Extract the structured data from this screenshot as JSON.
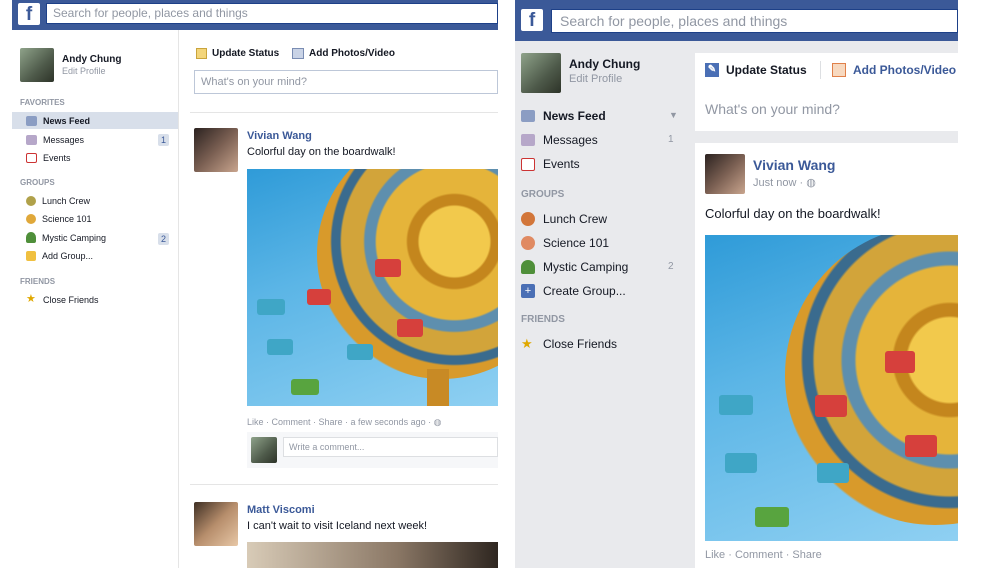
{
  "search": {
    "placeholder": "Search for people, places and things"
  },
  "logo": "f",
  "user": {
    "name": "Andy Chung",
    "sub": "Edit Profile"
  },
  "old_layout": {
    "sections": {
      "favorites": "FAVORITES",
      "groups": "GROUPS",
      "friends": "FRIENDS"
    },
    "favorites": [
      {
        "label": "News Feed",
        "icon": "news-feed-icon",
        "count": ""
      },
      {
        "label": "Messages",
        "icon": "messages-icon",
        "count": "1"
      },
      {
        "label": "Events",
        "icon": "events-icon",
        "count": ""
      }
    ],
    "groups": [
      {
        "label": "Lunch Crew",
        "icon": "lunch-crew-icon",
        "count": ""
      },
      {
        "label": "Science 101",
        "icon": "science-icon",
        "count": ""
      },
      {
        "label": "Mystic Camping",
        "icon": "tree-icon",
        "count": "2"
      },
      {
        "label": "Add Group...",
        "icon": "add-group-icon",
        "count": ""
      }
    ],
    "friends": [
      {
        "label": "Close Friends",
        "icon": "star-icon",
        "count": ""
      }
    ],
    "composer": {
      "update_status": "Update Status",
      "add_photos": "Add Photos/Video",
      "placeholder": "What's on your mind?"
    },
    "posts": [
      {
        "author": "Vivian Wang",
        "text": "Colorful day on the boardwalk!",
        "actions": "Like · Comment · Share · a few seconds ago · ",
        "comment_placeholder": "Write a comment..."
      },
      {
        "author": "Matt Viscomi",
        "text": "I can't wait to visit Iceland next week!"
      }
    ]
  },
  "new_layout": {
    "sections": {
      "groups": "GROUPS",
      "friends": "FRIENDS"
    },
    "favorites": [
      {
        "label": "News Feed",
        "icon": "news-feed-icon",
        "count": ""
      },
      {
        "label": "Messages",
        "icon": "messages-icon",
        "count": "1"
      },
      {
        "label": "Events",
        "icon": "events-icon",
        "count": ""
      }
    ],
    "groups": [
      {
        "label": "Lunch Crew",
        "icon": "lunch-crew-icon",
        "count": ""
      },
      {
        "label": "Science 101",
        "icon": "science-icon",
        "count": ""
      },
      {
        "label": "Mystic Camping",
        "icon": "tree-icon",
        "count": "2"
      },
      {
        "label": "Create Group...",
        "icon": "create-group-icon",
        "count": ""
      }
    ],
    "friends": [
      {
        "label": "Close Friends",
        "icon": "star-icon",
        "count": ""
      }
    ],
    "composer": {
      "update_status": "Update Status",
      "add_photos": "Add Photos/Video",
      "placeholder": "What's on your mind?"
    },
    "post": {
      "author": "Vivian Wang",
      "time": "Just now · ",
      "text": "Colorful day on the boardwalk!",
      "actions": "Like · Comment · Share"
    }
  },
  "colors": {
    "brand": "#3b5998",
    "muted": "#9197a3",
    "right_bg": "#e9eaed"
  }
}
